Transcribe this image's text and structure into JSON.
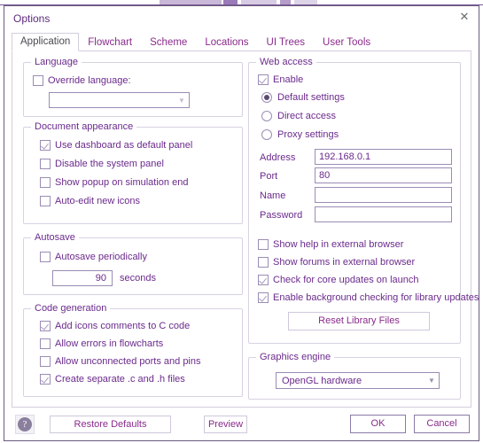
{
  "window": {
    "title": "Options",
    "close_icon": "close-icon"
  },
  "tabs": [
    {
      "label": "Application",
      "selected": true
    },
    {
      "label": "Flowchart",
      "selected": false
    },
    {
      "label": "Scheme",
      "selected": false
    },
    {
      "label": "Locations",
      "selected": false
    },
    {
      "label": "UI Trees",
      "selected": false
    },
    {
      "label": "User Tools",
      "selected": false
    }
  ],
  "left_column": {
    "language": {
      "legend": "Language",
      "override_checkbox": {
        "label": "Override language:",
        "checked": false
      },
      "language_combo": {
        "value": "",
        "enabled": false,
        "arrow_icon": "chevron-down-icon"
      }
    },
    "document_appearance": {
      "legend": "Document appearance",
      "items": [
        {
          "label": "Use dashboard as default panel",
          "checked": true
        },
        {
          "label": "Disable the system panel",
          "checked": false
        },
        {
          "label": "Show popup on simulation end",
          "checked": false
        },
        {
          "label": "Auto-edit new icons",
          "checked": false
        }
      ]
    },
    "autosave": {
      "legend": "Autosave",
      "periodically_checkbox": {
        "label": "Autosave periodically",
        "checked": false
      },
      "interval_value": "90",
      "interval_units": "seconds"
    },
    "code_generation": {
      "legend": "Code generation",
      "items": [
        {
          "label": "Add icons comments to C code",
          "checked": true
        },
        {
          "label": "Allow errors in flowcharts",
          "checked": false
        },
        {
          "label": "Allow unconnected ports and pins",
          "checked": false
        },
        {
          "label": "Create separate .c and .h files",
          "checked": true
        }
      ]
    }
  },
  "right_column": {
    "web_access": {
      "legend": "Web access",
      "enable_checkbox": {
        "label": "Enable",
        "checked": true
      },
      "radios": [
        {
          "label": "Default settings",
          "selected": true
        },
        {
          "label": "Direct access",
          "selected": false
        },
        {
          "label": "Proxy settings",
          "selected": false
        }
      ],
      "fields": [
        {
          "label": "Address",
          "value": "192.168.0.1"
        },
        {
          "label": "Port",
          "value": "80"
        },
        {
          "label": "Name",
          "value": ""
        },
        {
          "label": "Password",
          "value": ""
        }
      ],
      "checkboxes": [
        {
          "label": "Show help in external browser",
          "checked": false
        },
        {
          "label": "Show forums in external browser",
          "checked": false
        },
        {
          "label": "Check for core updates on launch",
          "checked": true
        },
        {
          "label": "Enable background checking for library updates",
          "checked": true
        }
      ],
      "reset_button": "Reset Library Files"
    },
    "graphics_engine": {
      "legend": "Graphics engine",
      "combo": {
        "value": "OpenGL hardware",
        "arrow_icon": "chevron-down-icon"
      }
    }
  },
  "footer": {
    "help_icon": "question-mark-icon",
    "restore_defaults": "Restore Defaults",
    "preview": "Preview",
    "ok": "OK",
    "cancel": "Cancel"
  },
  "colors": {
    "accent_text": "#6a2a8c",
    "tab_link": "#8a2a8c",
    "border": "#d8d2e2",
    "control_border": "#9b8cb5"
  }
}
